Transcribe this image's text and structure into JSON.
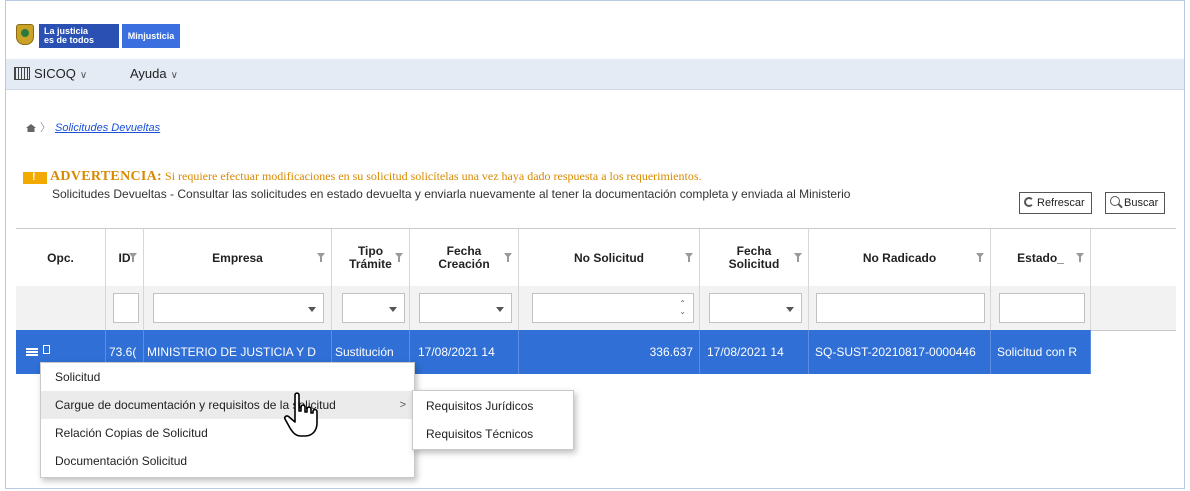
{
  "header": {
    "logo_line1": "La justicia",
    "logo_line2": "es de todos",
    "logo_brand": "Minjusticia"
  },
  "menubar": {
    "items": [
      {
        "label": "SICOQ",
        "icon": "app-grid-icon"
      },
      {
        "label": "Ayuda"
      }
    ],
    "chevron": "∨"
  },
  "breadcrumb": {
    "home_icon": "home-icon",
    "current": "Solicitudes Devueltas"
  },
  "warning": {
    "title": "ADVERTENCIA:",
    "message": "Si requiere efectuar modificaciones en su solicitud solicítelas una vez haya dado respuesta a los requerimientos."
  },
  "description": "Solicitudes Devueltas - Consultar las solicitudes en estado devuelta y enviarla nuevamente al tener la documentación completa y enviada al Ministerio",
  "toolbar": {
    "refresh_label": "Refrescar",
    "search_label": "Buscar"
  },
  "grid": {
    "columns": [
      {
        "key": "opc",
        "label": "Opc."
      },
      {
        "key": "id",
        "label": "ID"
      },
      {
        "key": "empresa",
        "label": "Empresa"
      },
      {
        "key": "tipo",
        "label": "Tipo",
        "label2": "Trámite"
      },
      {
        "key": "fecha_creacion",
        "label": "Fecha",
        "label2": "Creación"
      },
      {
        "key": "no_solicitud",
        "label": "No Solicitud"
      },
      {
        "key": "fecha_solicitud",
        "label": "Fecha",
        "label2": "Solicitud"
      },
      {
        "key": "no_radicado",
        "label": "No Radicado"
      },
      {
        "key": "estado",
        "label": "Estado_"
      }
    ],
    "rows": [
      {
        "id": "73.6(",
        "empresa": "MINISTERIO DE JUSTICIA Y D",
        "tipo": "Sustitución",
        "fecha_creacion": "17/08/2021 14",
        "no_solicitud": "336.637",
        "fecha_solicitud": "17/08/2021 14",
        "no_radicado": "SQ-SUST-20210817-0000446",
        "estado": "Solicitud con R"
      }
    ]
  },
  "context_menu": {
    "items": [
      {
        "label": "Solicitud"
      },
      {
        "label": "Cargue de documentación y requisitos de la solicitud",
        "has_submenu": true
      },
      {
        "label": "Relación Copias de Solicitud"
      },
      {
        "label": "Documentación Solicitud"
      }
    ],
    "submenu_arrow": ">"
  },
  "submenu": {
    "items": [
      {
        "label": "Requisitos Jurídicos"
      },
      {
        "label": "Requisitos Técnicos"
      }
    ]
  },
  "colors": {
    "selected_row": "#2f6fd6",
    "warning": "#d98a00",
    "menubar": "#e4ebf5"
  }
}
